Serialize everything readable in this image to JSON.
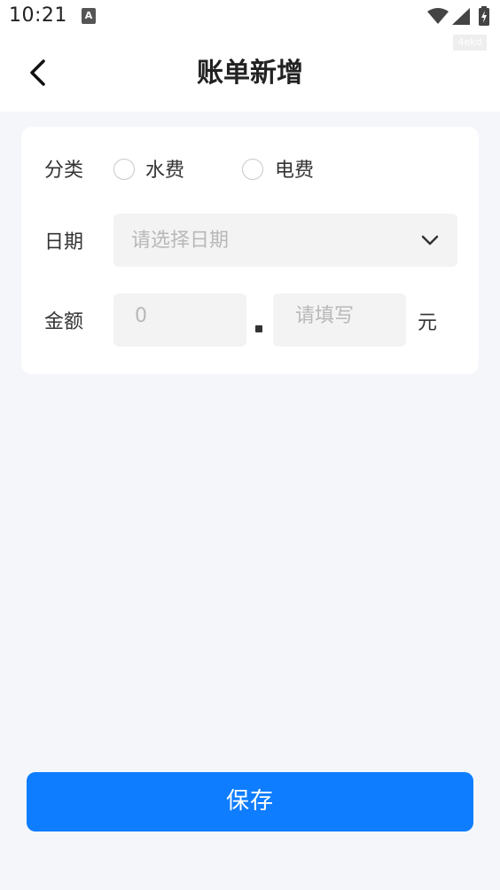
{
  "status_bar": {
    "time": "10:21",
    "app_icon_letter": "A",
    "watermark": "4ekd"
  },
  "header": {
    "title": "账单新增",
    "back_icon": "chevron-left-icon"
  },
  "form": {
    "category_label": "分类",
    "category_options": [
      "水费",
      "电费"
    ],
    "date_label": "日期",
    "date_placeholder": "请选择日期",
    "amount_label": "金额",
    "amount_integer_placeholder": "0",
    "amount_decimal_placeholder": "请填写",
    "amount_unit": "元"
  },
  "footer": {
    "save_label": "保存"
  },
  "colors": {
    "accent": "#0f7dff",
    "page_background": "#f4f6fa",
    "card_background": "#ffffff",
    "placeholder": "#b8b8b8"
  }
}
